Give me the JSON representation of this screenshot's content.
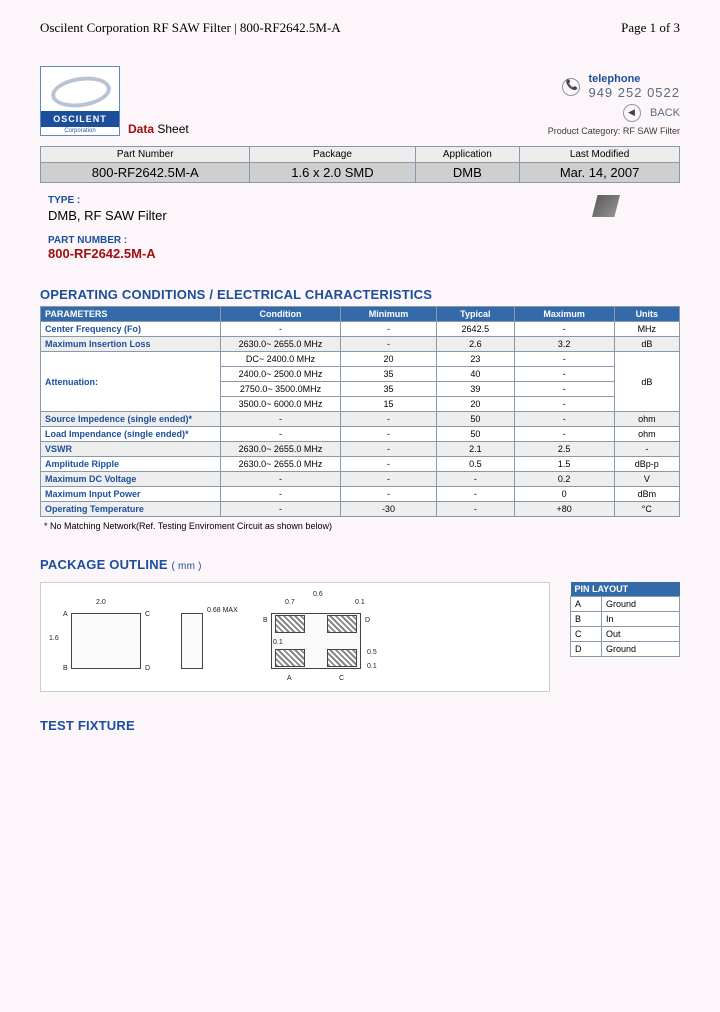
{
  "page": {
    "header_left": "Oscilent Corporation RF SAW Filter | 800-RF2642.5M-A",
    "header_right": "Page 1 of 3"
  },
  "logo": {
    "brand": "OSCILENT",
    "sub": "Corporation"
  },
  "datasheet": {
    "word_data": "Data",
    "word_sheet": " Sheet"
  },
  "contact": {
    "tele_label": "telephone",
    "tele_num": "949 252 0522",
    "back_label": "BACK",
    "prodcat_label": "Product Category: ",
    "prodcat_value": "RF SAW Filter"
  },
  "infotable": {
    "headers": [
      "Part Number",
      "Package",
      "Application",
      "Last Modified"
    ],
    "values": [
      "800-RF2642.5M-A",
      "1.6 x 2.0 SMD",
      "DMB",
      "Mar. 14, 2007"
    ]
  },
  "type": {
    "label": "TYPE :",
    "value": "DMB, RF SAW Filter",
    "pn_label": "PART NUMBER :",
    "pn_value": "800-RF2642.5M-A"
  },
  "sections": {
    "spec": "OPERATING CONDITIONS / ELECTRICAL CHARACTERISTICS",
    "pkg": "PACKAGE OUTLINE",
    "pkg_mm": "( mm )",
    "test": "TEST FIXTURE"
  },
  "spec": {
    "headers": [
      "PARAMETERS",
      "Condition",
      "Minimum",
      "Typical",
      "Maximum",
      "Units"
    ],
    "rows": [
      {
        "param": "Center Frequency (Fo)",
        "cond": "-",
        "min": "-",
        "typ": "2642.5",
        "max": "-",
        "unit": "MHz",
        "alt": false
      },
      {
        "param": "Maximum Insertion Loss",
        "cond": "2630.0~ 2655.0 MHz",
        "min": "-",
        "typ": "2.6",
        "max": "3.2",
        "unit": "dB",
        "alt": true
      },
      {
        "param": "Attenuation:",
        "cond": "DC~ 2400.0 MHz",
        "min": "20",
        "typ": "23",
        "max": "-",
        "unit_rowspan": "dB",
        "alt": false
      },
      {
        "param": "",
        "cond": "2400.0~ 2500.0 MHz",
        "min": "35",
        "typ": "40",
        "max": "-",
        "alt": false
      },
      {
        "param": "",
        "cond": "2750.0~ 3500.0MHz",
        "min": "35",
        "typ": "39",
        "max": "-",
        "alt": false
      },
      {
        "param": "",
        "cond": "3500.0~ 6000.0 MHz",
        "min": "15",
        "typ": "20",
        "max": "-",
        "alt": false
      },
      {
        "param": "Source Impedence (single ended)*",
        "cond": "-",
        "min": "-",
        "typ": "50",
        "max": "-",
        "unit": "ohm",
        "alt": true
      },
      {
        "param": "Load Impendance (single ended)*",
        "cond": "-",
        "min": "-",
        "typ": "50",
        "max": "-",
        "unit": "ohm",
        "alt": false
      },
      {
        "param": "VSWR",
        "cond": "2630.0~ 2655.0 MHz",
        "min": "-",
        "typ": "2.1",
        "max": "2.5",
        "unit": "-",
        "alt": true
      },
      {
        "param": "Amplitude Ripple",
        "cond": "2630.0~ 2655.0 MHz",
        "min": "-",
        "typ": "0.5",
        "max": "1.5",
        "unit": "dBp-p",
        "alt": false
      },
      {
        "param": "Maximum DC Voltage",
        "cond": "-",
        "min": "-",
        "typ": "-",
        "max": "0.2",
        "unit": "V",
        "alt": true
      },
      {
        "param": "Maximum Input Power",
        "cond": "-",
        "min": "-",
        "typ": "-",
        "max": "0",
        "unit": "dBm",
        "alt": false
      },
      {
        "param": "Operating Temperature",
        "cond": "-",
        "min": "-30",
        "typ": "-",
        "max": "+80",
        "unit": "°C",
        "alt": true
      }
    ],
    "footnote": "* No Matching Network(Ref. Testing Enviroment Circuit as shown below)"
  },
  "pkg_dims": {
    "w": "2.0",
    "h": "1.6",
    "thick": "0.68 MAX",
    "pad_w": "0.7",
    "pad_gap": "0.6",
    "pad_edge": "0.1",
    "pad_h": "0.5",
    "pad_inset": "0.1",
    "pins": [
      "A",
      "B",
      "C",
      "D"
    ]
  },
  "pinlayout": {
    "header": "PIN LAYOUT",
    "rows": [
      [
        "A",
        "Ground"
      ],
      [
        "B",
        "In"
      ],
      [
        "C",
        "Out"
      ],
      [
        "D",
        "Ground"
      ]
    ]
  }
}
